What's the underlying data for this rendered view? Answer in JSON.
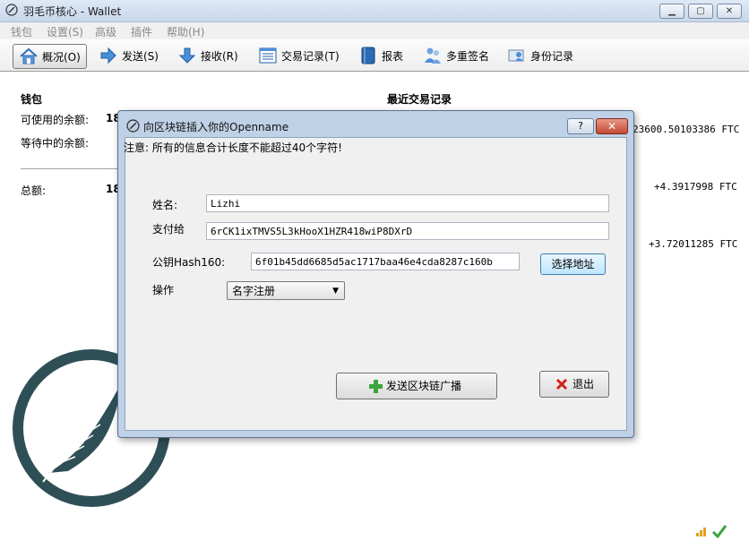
{
  "window": {
    "title": "羽毛币核心 - Wallet",
    "controls": [
      "minimize",
      "maximize",
      "close"
    ]
  },
  "menu": [
    "钱包",
    "设置(S)",
    "高级",
    "插件",
    "帮助(H)"
  ],
  "toolbar": [
    {
      "label": "概况(O)",
      "icon": "home-icon",
      "active": true
    },
    {
      "label": "发送(S)",
      "icon": "send-arrow-icon",
      "active": false
    },
    {
      "label": "接收(R)",
      "icon": "receive-arrow-icon",
      "active": false
    },
    {
      "label": "交易记录(T)",
      "icon": "transactions-list-icon",
      "active": false
    },
    {
      "label": "报表",
      "icon": "report-book-icon",
      "active": false
    },
    {
      "label": "多重签名",
      "icon": "multisig-users-icon",
      "active": false
    },
    {
      "label": "身份记录",
      "icon": "identity-icon",
      "active": false
    }
  ],
  "wallet": {
    "heading": "钱包",
    "available_label": "可使用的余额:",
    "available_value_visible": "18",
    "pending_label": "等待中的余额:",
    "total_label": "总额:",
    "total_value_visible": "18"
  },
  "recent": {
    "heading": "最近交易记录",
    "items": [
      "23600.50103386 FTC",
      "+4.3917998 FTC",
      "+3.72011285 FTC"
    ]
  },
  "dialog": {
    "title": "向区块链插入你的Openname",
    "help": "?",
    "close": "✕",
    "notice": "注意: 所有的信息合计长度不能超过40个字符!",
    "name_label": "姓名:",
    "name_value": "Lizhi",
    "payto_label": "支付给",
    "payto_value": "6rCK1ixTMVS5L3kHooX1HZR418wiP8DXrD",
    "pubkey_label": "公钥Hash160:",
    "pubkey_value": "6f01b45dd6685d5ac1717baa46e4cda8287c160b",
    "choose_address_button": "选择地址",
    "op_label": "操作",
    "op_selected": "名字注册",
    "broadcast_button": "发送区块链广播",
    "exit_button": "退出"
  },
  "colors": {
    "accent": "#2f6fb7",
    "dialog_frame": "#bfd1e6",
    "logo": "#2f4f56",
    "close_red": "#c24a36"
  }
}
